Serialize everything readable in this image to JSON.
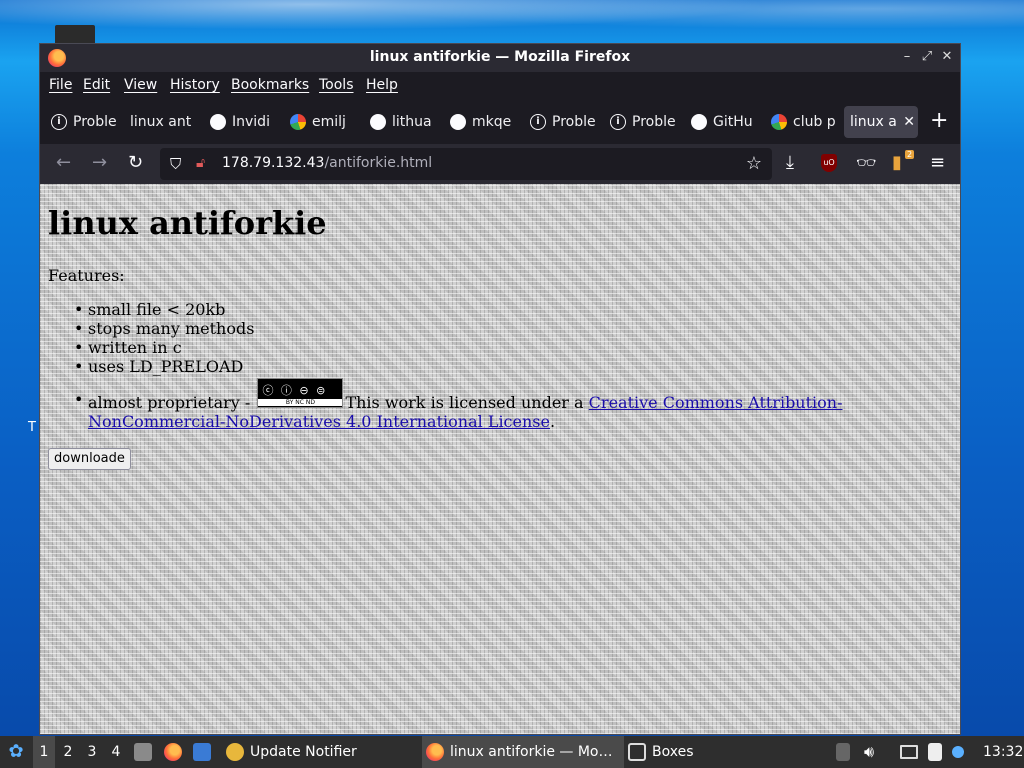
{
  "desktop": {
    "stray_char": "T"
  },
  "window": {
    "title": "linux antiforkie — Mozilla Firefox",
    "controls": {
      "minimize": "–",
      "maximize": "⤢",
      "close": "✕"
    }
  },
  "menu": [
    "File",
    "Edit",
    "View",
    "History",
    "Bookmarks",
    "Tools",
    "Help"
  ],
  "tabs": [
    {
      "label": "Proble",
      "icon": "info"
    },
    {
      "label": "linux ant",
      "icon": "none"
    },
    {
      "label": "Invidi",
      "icon": "invidious"
    },
    {
      "label": "emilj",
      "icon": "google"
    },
    {
      "label": "lithua",
      "icon": "github"
    },
    {
      "label": "mkqe",
      "icon": "github"
    },
    {
      "label": "Proble",
      "icon": "info"
    },
    {
      "label": "Proble",
      "icon": "info"
    },
    {
      "label": "GitHu",
      "icon": "github"
    },
    {
      "label": "club p",
      "icon": "google"
    },
    {
      "label": "linux a",
      "icon": "none",
      "active": true
    }
  ],
  "tab_close": "✕",
  "new_tab": "+",
  "nav": {
    "back": "←",
    "forward": "→",
    "reload": "↻",
    "url_host": "178.79.132.43",
    "url_path": "/antiforkie.html",
    "extension_badge": "2",
    "ublock_label": "uO"
  },
  "page": {
    "heading": "linux antiforkie",
    "features_label": "Features:",
    "features": [
      "small file < 20kb",
      "stops many methods",
      "written in c",
      "uses LD_PRELOAD"
    ],
    "license_prefix": "almost proprietary -",
    "cc_badge_symbols": "ⓒ ⓘ ⊖ ⊜",
    "cc_badge_label": "BY   NC   ND",
    "license_text": "This work is licensed under a",
    "license_link": "Creative Commons Attribution-NonCommercial-NoDerivatives 4.0 International License",
    "license_suffix": ".",
    "download_button": "downloade"
  },
  "taskbar": {
    "workspaces": [
      "1",
      "2",
      "3",
      "4"
    ],
    "active_workspace": "1",
    "tasks": [
      {
        "label": "Update Notifier"
      },
      {
        "label": "linux antiforkie — Mo…",
        "active": true
      },
      {
        "label": "Boxes"
      }
    ],
    "clock": "13:32"
  },
  "colors": {
    "firefox_chrome": "#1c1b22",
    "active_tab": "#42414d",
    "link": "#1a0dab",
    "taskbar": "#2e2e2e"
  }
}
